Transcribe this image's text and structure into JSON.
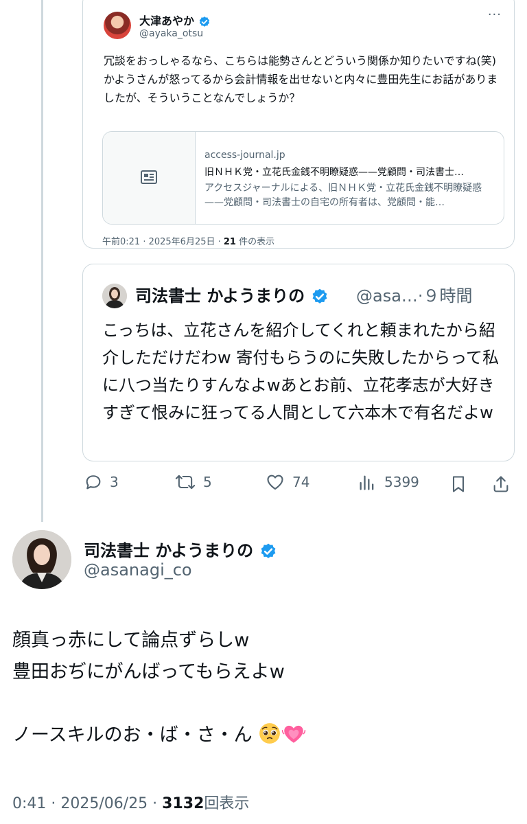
{
  "quoted_tweet": {
    "author_name": "大津あやか",
    "author_handle": "@ayaka_otsu",
    "text": "冗談をおっしゃるなら、こちらは能勢さんとどういう関係か知りたいですね(笑)\nかようさんが怒ってるから会計情報を出せないと内々に豊田先生にお話がありましたが、そういうことなんでしょうか？",
    "link_card": {
      "domain": "access-journal.jp",
      "title": "旧ＮＨＫ党・立花氏金銭不明瞭疑惑——党顧問・司法書士…",
      "description": "アクセスジャーナルによる、旧ＮＨＫ党・立花氏金銭不明瞭疑惑——党顧問・司法書士の自宅の所有者は、党顧問・能…"
    },
    "timestamp": "午前0:21 · 2025年6月25日 · ",
    "views_count": "21",
    "views_label": " 件の表示"
  },
  "reply_tweet": {
    "author_name": "司法書士 かようまりの",
    "author_handle": "@asa…",
    "time": "·９時間",
    "text": "こっちは、立花さんを紹介してくれと頼まれたから紹介しただけだわw 寄付もらうのに失敗したからって私に八つ当たりすんなよwあとお前、立花孝志が大好きすぎて恨みに狂ってる人間として六本木で有名だよw",
    "actions": {
      "replies": "3",
      "reposts": "5",
      "likes": "74",
      "views": "5399"
    }
  },
  "main_tweet": {
    "author_name": "司法書士 かようまりの",
    "author_handle": "@asanagi_co",
    "text": "顔真っ赤にして論点ずらしw\n豊田おぢにがんばってもらえよw\n\nノースキルのお・ば・さ・ん",
    "time_date": "0:41 · 2025/06/25 · ",
    "views_count": "3132",
    "views_label": "回表示"
  },
  "colors": {
    "verified": "#1d9bf0",
    "text_primary": "#0f1419",
    "text_secondary": "#536471",
    "border": "#cfd9de"
  },
  "icons": [
    "verified-badge-icon",
    "more-icon",
    "article-icon",
    "reply-icon",
    "repost-icon",
    "like-icon",
    "views-icon",
    "bookmark-icon",
    "share-icon",
    "pleading-face-icon",
    "growing-heart-icon"
  ]
}
